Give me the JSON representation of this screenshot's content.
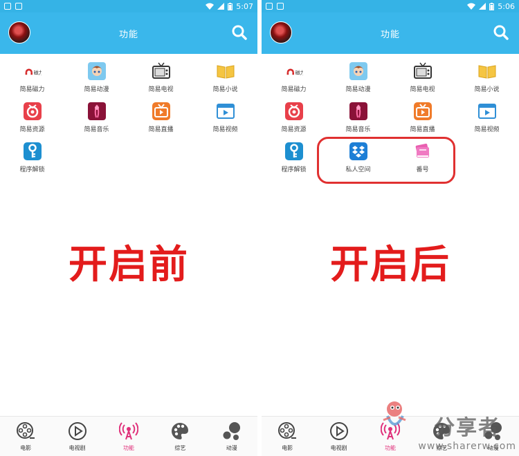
{
  "left": {
    "status_time": "5:07",
    "title": "功能",
    "caption": "开启前",
    "grid": [
      {
        "label": "简易磁力",
        "icon": "magnet-icon"
      },
      {
        "label": "简易动漫",
        "icon": "anime-icon"
      },
      {
        "label": "简易电视",
        "icon": "tv-icon"
      },
      {
        "label": "简易小说",
        "icon": "book-icon"
      },
      {
        "label": "简易资源",
        "icon": "resource-icon"
      },
      {
        "label": "简易音乐",
        "icon": "music-icon"
      },
      {
        "label": "简易直播",
        "icon": "live-icon"
      },
      {
        "label": "简易视频",
        "icon": "video-icon"
      },
      {
        "label": "程序解锁",
        "icon": "key-icon"
      }
    ]
  },
  "right": {
    "status_time": "5:06",
    "title": "功能",
    "caption": "开启后",
    "grid": [
      {
        "label": "简易磁力",
        "icon": "magnet-icon"
      },
      {
        "label": "简易动漫",
        "icon": "anime-icon"
      },
      {
        "label": "简易电视",
        "icon": "tv-icon"
      },
      {
        "label": "简易小说",
        "icon": "book-icon"
      },
      {
        "label": "简易资源",
        "icon": "resource-icon"
      },
      {
        "label": "简易音乐",
        "icon": "music-icon"
      },
      {
        "label": "简易直播",
        "icon": "live-icon"
      },
      {
        "label": "简易视频",
        "icon": "video-icon"
      },
      {
        "label": "程序解锁",
        "icon": "key-icon"
      },
      {
        "label": "私人空间",
        "icon": "dropbox-icon"
      },
      {
        "label": "番号",
        "icon": "pink-book-icon"
      }
    ]
  },
  "nav": [
    {
      "label": "电影",
      "icon": "film-reel-icon"
    },
    {
      "label": "电视剧",
      "icon": "play-icon"
    },
    {
      "label": "功能",
      "icon": "broadcast-icon",
      "active": true
    },
    {
      "label": "综艺",
      "icon": "palette-icon"
    },
    {
      "label": "动漫",
      "icon": "bubbles-icon"
    }
  ],
  "watermark": {
    "main": "分享者",
    "sub": "www.sharerw.com"
  },
  "colors": {
    "appbar": "#3ab7eb",
    "statusbar": "#35b3e6",
    "accent_red": "#e31c1c",
    "nav_active": "#e0307a"
  }
}
